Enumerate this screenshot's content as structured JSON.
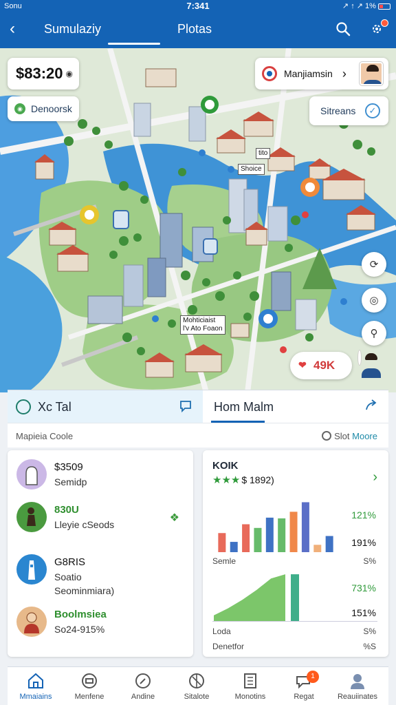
{
  "status": {
    "left": "Sonu",
    "time": "7:341",
    "right": "↗ ↑ ↗ 1%"
  },
  "header": {
    "tab_1": "Sumulaziy",
    "tab_2": "Plotas"
  },
  "map": {
    "price": "$83:20",
    "place": "Denoorsk",
    "user_name": "Manjiamsin",
    "status_chip": "Sitreans",
    "money_chip": "49K",
    "labels": {
      "tower": "Shoice",
      "center_1": "Mohticiaist",
      "center_2": "l'v Ato Foaon",
      "badge": "tito"
    }
  },
  "panel": {
    "tab_left": "Xc Tal",
    "tab_right": "Hom Malm",
    "sub_left": "Mapieia Coole",
    "sub_right_1": "Slot",
    "sub_right_2": "Moore"
  },
  "list": [
    {
      "line1": "$3509",
      "line2": "Semidp",
      "line3": ""
    },
    {
      "line1": "830U",
      "line2": "Lleyie cSeods",
      "line3": ""
    },
    {
      "line1": "G8RIS",
      "line2": "Soatio",
      "line3": "Seominmiara)"
    },
    {
      "line1": "Boolmsiea",
      "line2": "So24-915%",
      "line3": ""
    }
  ],
  "stats_card": {
    "title": "KOIK",
    "rating_text": "$ 1892)",
    "pct_1": "121%",
    "pct_2": "191%",
    "label_1": "Semle",
    "label_1_value": "S%",
    "pct_3": "731%",
    "pct_4": "151%",
    "label_2": "Loda",
    "label_2_value": "S%",
    "label_3": "Denetfor",
    "label_3_value": "%S"
  },
  "chart_data": [
    {
      "type": "bar",
      "categories": [
        "1",
        "2",
        "3",
        "4",
        "5",
        "6",
        "7",
        "8",
        "9",
        "10"
      ],
      "values": [
        26,
        14,
        38,
        33,
        47,
        46,
        55,
        68,
        10,
        22
      ],
      "colors": [
        "#e86a5a",
        "#3f72c4",
        "#e86a5a",
        "#66bb6a",
        "#3f72c4",
        "#66bb6a",
        "#f0884a",
        "#5b6fc7",
        "#f0b07a",
        "#3f72c4"
      ],
      "ylim": [
        0,
        75
      ]
    },
    {
      "type": "area",
      "x": [
        0,
        1,
        2,
        3,
        4,
        5
      ],
      "values": [
        8,
        18,
        30,
        44,
        60,
        66
      ],
      "ylim": [
        0,
        70
      ],
      "color": "#7cc66a",
      "accent_bar": 66
    }
  ],
  "nav": [
    {
      "label": "Mmaiains",
      "icon": "home-icon"
    },
    {
      "label": "Menfene",
      "icon": "wallet-icon"
    },
    {
      "label": "Andine",
      "icon": "compass-icon"
    },
    {
      "label": "Sitalote",
      "icon": "globe-icon"
    },
    {
      "label": "Monotins",
      "icon": "building-icon"
    },
    {
      "label": "Regat",
      "icon": "chat-icon"
    },
    {
      "label": "Reauiinates",
      "icon": "profile-icon"
    }
  ],
  "nav_badge": "1",
  "colors": {
    "brand": "#1463b5",
    "accent_green": "#2f9a3a",
    "alert": "#ff5a1c",
    "water": "#3f93d6"
  }
}
